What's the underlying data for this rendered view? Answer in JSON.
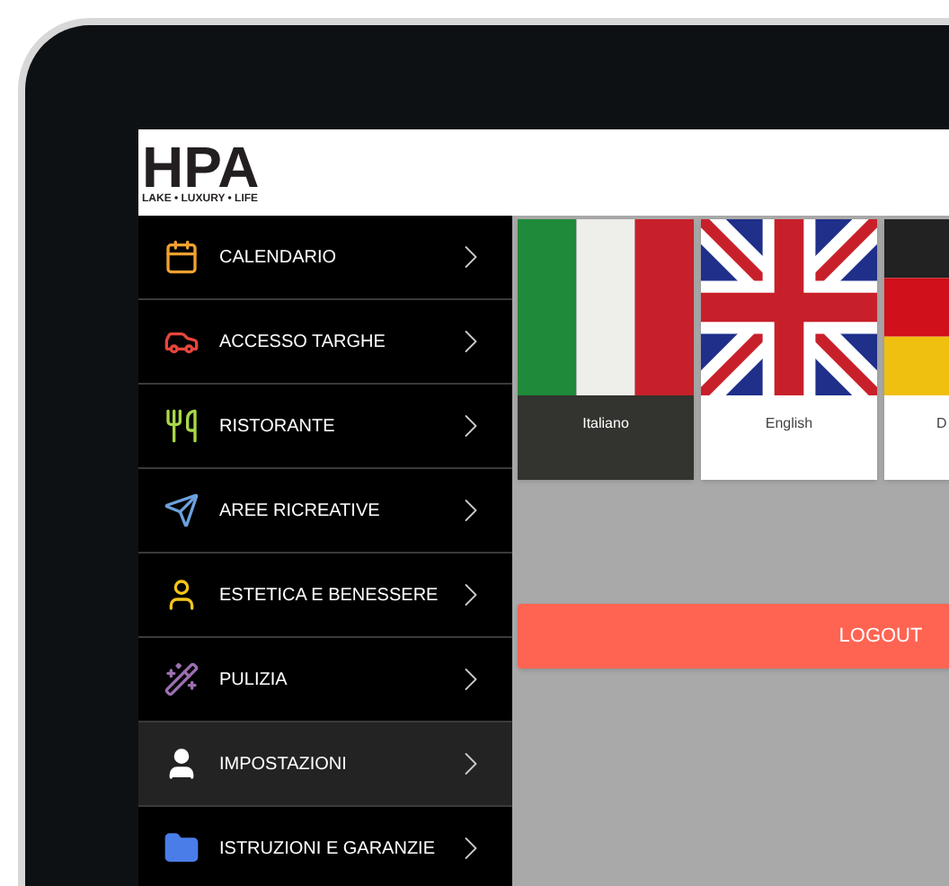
{
  "header": {
    "logo": "HPA",
    "tagline": "LAKE • LUXURY • LIFE"
  },
  "menu": [
    {
      "label": "CALENDARIO",
      "color": "#f0a030",
      "selected": false
    },
    {
      "label": "ACCESSO TARGHE",
      "color": "#e8453c",
      "selected": false
    },
    {
      "label": "RISTORANTE",
      "color": "#a8d848",
      "selected": false
    },
    {
      "label": "AREE RICREATIVE",
      "color": "#6ca0dc",
      "selected": false
    },
    {
      "label": "ESTETICA E BENESSERE",
      "color": "#f5c518",
      "selected": false
    },
    {
      "label": "PULIZIA",
      "color": "#9b6fb0",
      "selected": false
    },
    {
      "label": "IMPOSTAZIONI",
      "color": "#ffffff",
      "selected": true
    },
    {
      "label": "ISTRUZIONI E GARANZIE",
      "color": "#4a7de8",
      "selected": false
    }
  ],
  "languages": [
    {
      "label": "Italiano",
      "kind": "italy",
      "selected": true
    },
    {
      "label": "English",
      "kind": "uk",
      "selected": false
    },
    {
      "label": "D",
      "kind": "germany",
      "selected": false
    }
  ],
  "logout_button": "LOGOUT"
}
